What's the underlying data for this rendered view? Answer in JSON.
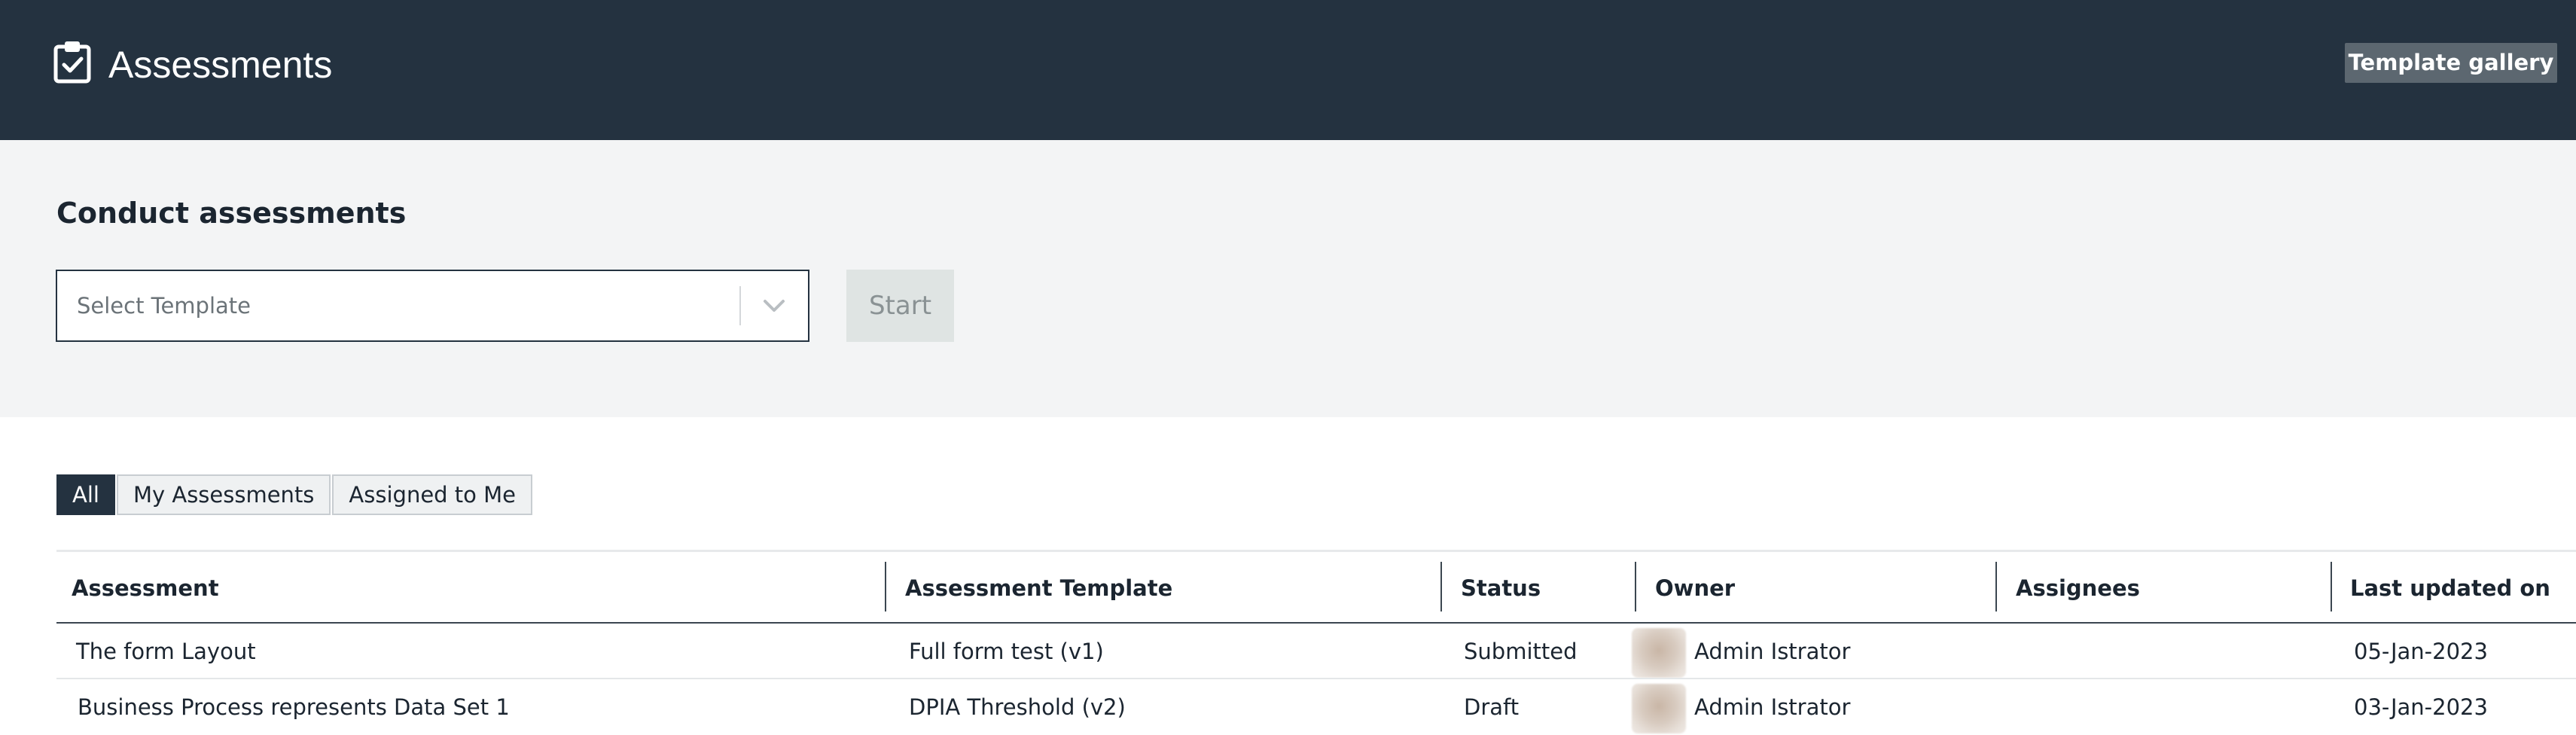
{
  "header": {
    "title": "Assessments",
    "icon": "clipboard-check-icon",
    "gallery_button": "Template gallery",
    "background": "#243240"
  },
  "conduct": {
    "title": "Conduct assessments",
    "select": {
      "placeholder": "Select Template",
      "icon": "chevron-down-icon"
    },
    "start_button": "Start"
  },
  "tabs": [
    {
      "label": "All",
      "active": true
    },
    {
      "label": "My Assessments",
      "active": false
    },
    {
      "label": "Assigned to Me",
      "active": false
    }
  ],
  "table": {
    "columns": [
      "Assessment",
      "Assessment Template",
      "Status",
      "Owner",
      "Assignees",
      "Last updated on"
    ],
    "rows": [
      {
        "assessment": "The form Layout",
        "template": "Full form test (v1)",
        "status": "Submitted",
        "owner": "Admin Istrator",
        "assignees": "",
        "updated": "05-Jan-2023"
      },
      {
        "assessment": "Business Process represents Data Set 1",
        "template": "DPIA Threshold (v2)",
        "status": "Draft",
        "owner": "Admin Istrator",
        "assignees": "",
        "updated": "03-Jan-2023"
      }
    ]
  }
}
